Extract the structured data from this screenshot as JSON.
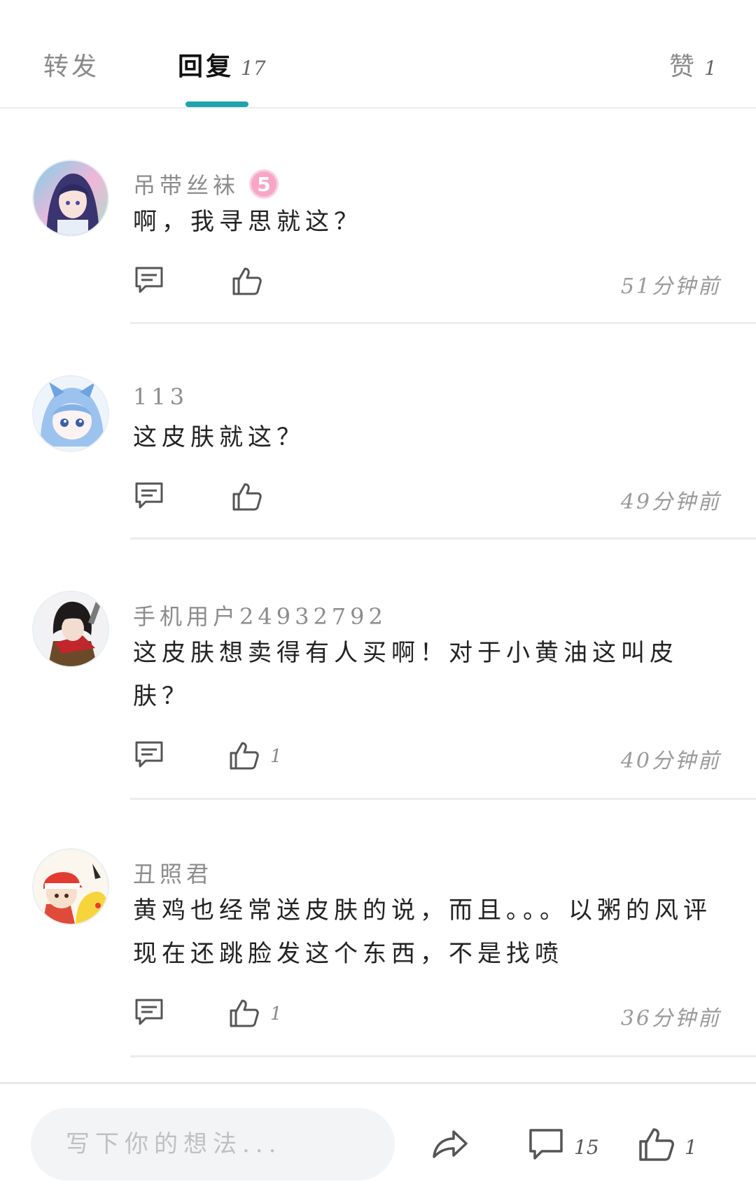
{
  "tabs": {
    "repost": "转发",
    "reply": "回复",
    "reply_count": "17",
    "like": "赞",
    "like_count": "1",
    "accent_color": "#1fa4ad"
  },
  "comments": [
    {
      "username": "吊带丝袜",
      "level": "5",
      "text": "啊，我寻思就这？",
      "time": "51分钟前",
      "likes": "",
      "icons": {
        "reply": "comment-icon",
        "like": "thumbs-up-icon"
      }
    },
    {
      "username": "113",
      "text": "这皮肤就这？",
      "time": "49分钟前",
      "likes": ""
    },
    {
      "username": "手机用户24932792",
      "text": "这皮肤想卖得有人买啊！对于小黄油这叫皮肤？",
      "time": "40分钟前",
      "likes": "1"
    },
    {
      "username": "丑照君",
      "text": "黄鸡也经常送皮肤的说，而且。。。以粥的风评现在还跳脸发这个东西，不是找喷",
      "time": "36分钟前",
      "likes": "1"
    }
  ],
  "bottom_bar": {
    "placeholder": "写下你的想法...",
    "comment_count": "15",
    "like_count": "1",
    "icons": [
      "share-icon",
      "comment-icon",
      "thumbs-up-icon"
    ]
  }
}
